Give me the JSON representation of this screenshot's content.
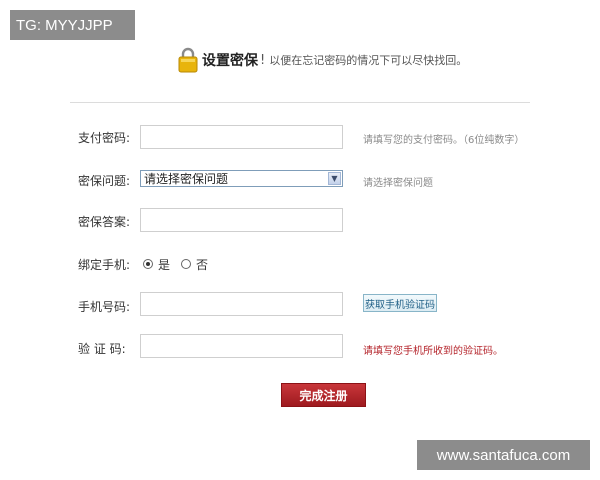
{
  "watermark": {
    "top_left": "TG: MYYJJPP",
    "bottom_right": "www.santafuca.com"
  },
  "header": {
    "title": "设置密保",
    "exclaim": "!",
    "subtitle": "以便在忘记密码的情况下可以尽快找回。"
  },
  "form": {
    "pay_password": {
      "label": "支付密码:",
      "value": "",
      "hint": "请填写您的支付密码。（6位纯数字）"
    },
    "security_question": {
      "label": "密保问题:",
      "selected": "请选择密保问题",
      "hint": "请选择密保问题"
    },
    "security_answer": {
      "label": "密保答案:",
      "value": ""
    },
    "bind_phone": {
      "label": "绑定手机:",
      "options": [
        "是",
        "否"
      ],
      "selected": "是"
    },
    "phone_number": {
      "label": "手机号码:",
      "value": "",
      "button": "获取手机验证码"
    },
    "verify_code": {
      "label": "验 证 码:",
      "value": "",
      "hint": "请填写您手机所收到的验证码。"
    },
    "submit": "完成注册"
  },
  "colors": {
    "hint_red": "#b4232a",
    "submit_bg": "#b5252b",
    "lock": "#e8b40c"
  }
}
